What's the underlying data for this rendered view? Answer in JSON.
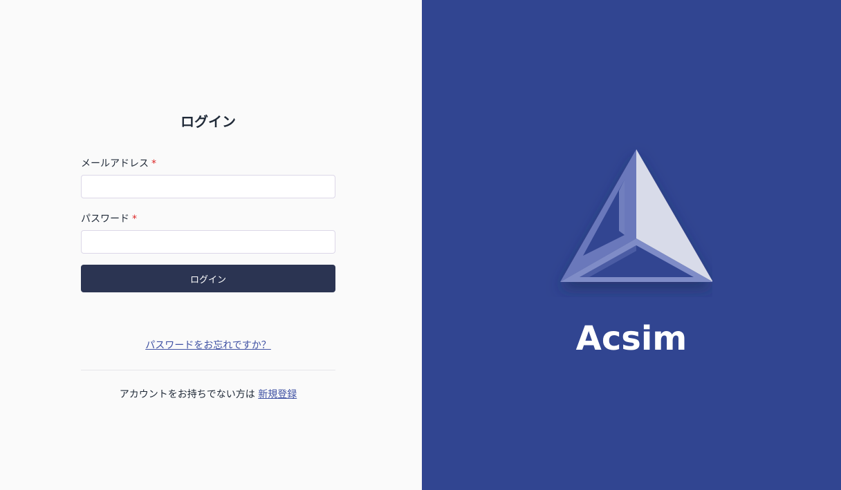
{
  "login": {
    "title": "ログイン",
    "email_label": "メールアドレス",
    "password_label": "パスワード",
    "required_mark": "*",
    "email_value": "",
    "password_value": "",
    "submit_label": "ログイン",
    "forgot_password_link": "パスワードをお忘れですか？",
    "signup_prompt": "アカウントをお持ちでない方は",
    "signup_link": "新規登録"
  },
  "brand": {
    "name": "Acsim",
    "logo_icon": "triangle-logo-icon",
    "background_color": "#314591"
  },
  "colors": {
    "button_bg": "#2b3452",
    "link": "#3f51a3",
    "required": "#dc2626"
  }
}
